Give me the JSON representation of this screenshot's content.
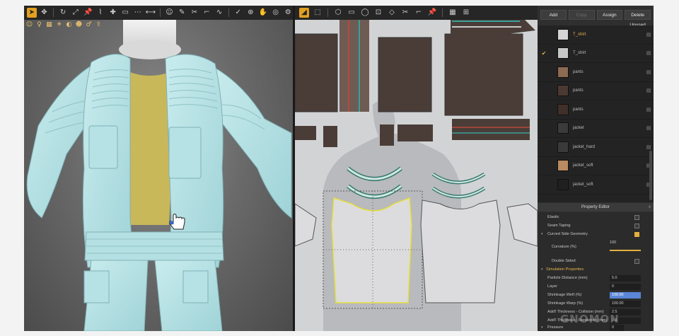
{
  "toolbar_3d": {
    "tools": [
      "select-arrow",
      "move",
      "rotate",
      "scale",
      "pin",
      "fold",
      "tack",
      "tape",
      "stitch",
      "measure",
      "avatar",
      "brush",
      "sew",
      "segment",
      "free-sew",
      "check",
      "zoom",
      "pan",
      "orbit",
      "settings"
    ],
    "sub_tools": [
      "avatar",
      "pose",
      "texture",
      "light",
      "paint",
      "people",
      "figure",
      "export"
    ]
  },
  "toolbar_2d": {
    "tools": [
      "edit-pattern",
      "transform",
      "polygon",
      "rectangle",
      "circle",
      "internal",
      "dart",
      "sew",
      "segment",
      "pin",
      "texture",
      "grade"
    ]
  },
  "library": {
    "buttons": {
      "add": "Add",
      "copy": "Copy",
      "assign": "Assign",
      "delete_unused": "Delete Unused"
    },
    "fabrics": [
      {
        "name": "T_shirt",
        "checked": false,
        "highlight": true,
        "color": "#d4d4d4"
      },
      {
        "name": "T_shirt",
        "checked": true,
        "highlight": false,
        "color": "#c7c7c7"
      },
      {
        "name": "pants",
        "checked": false,
        "highlight": false,
        "color": "#8d6a52"
      },
      {
        "name": "pants",
        "checked": false,
        "highlight": false,
        "color": "#4b3a31"
      },
      {
        "name": "pants",
        "checked": false,
        "highlight": false,
        "color": "#3f3029"
      },
      {
        "name": "jacket",
        "checked": false,
        "highlight": false,
        "color": "#3b3b3b"
      },
      {
        "name": "jacket_hard",
        "checked": false,
        "highlight": false,
        "color": "#3a3a3a"
      },
      {
        "name": "jacket_soft",
        "checked": false,
        "highlight": false,
        "color": "#b88b60"
      },
      {
        "name": "jacket_soft",
        "checked": false,
        "highlight": false,
        "color": "#202020"
      }
    ]
  },
  "property_editor": {
    "title": "Property Editor",
    "close": "x",
    "rows": {
      "elastic": "Elastic",
      "seam_taping": "Seam Taping",
      "curved_side_geometry": "Curved Side Geometry",
      "curvature": "Curvature (%)",
      "curvature_value": "100",
      "double_sided": "Double Sided",
      "simulation_properties": "Simulation Properties",
      "particle_distance": "Particle Distance (mm)",
      "particle_distance_value": "5.0",
      "layer": "Layer",
      "layer_value": "0",
      "shrinkage_weft": "Shrinkage Weft (%)",
      "shrinkage_weft_value": "100.00",
      "shrinkage_warp": "Shrinkage Warp (%)",
      "shrinkage_warp_value": "100.00",
      "thickness_collision": "Add'l Thickness - Collision (mm)",
      "thickness_collision_value": "2.5",
      "thickness_rendering": "Add'l Thickness - Rendering (mm)",
      "thickness_rendering_value": "0.0",
      "pressure": "Pressure",
      "pressure_value": "0"
    },
    "curvature_fraction": 1.0
  },
  "watermark": "GNOMON",
  "colors": {
    "accent": "#e3b040",
    "selected_pattern": "#e6e03a",
    "panel_bg": "#2f2f2f",
    "pattern_fabric": "#4a3d38"
  }
}
